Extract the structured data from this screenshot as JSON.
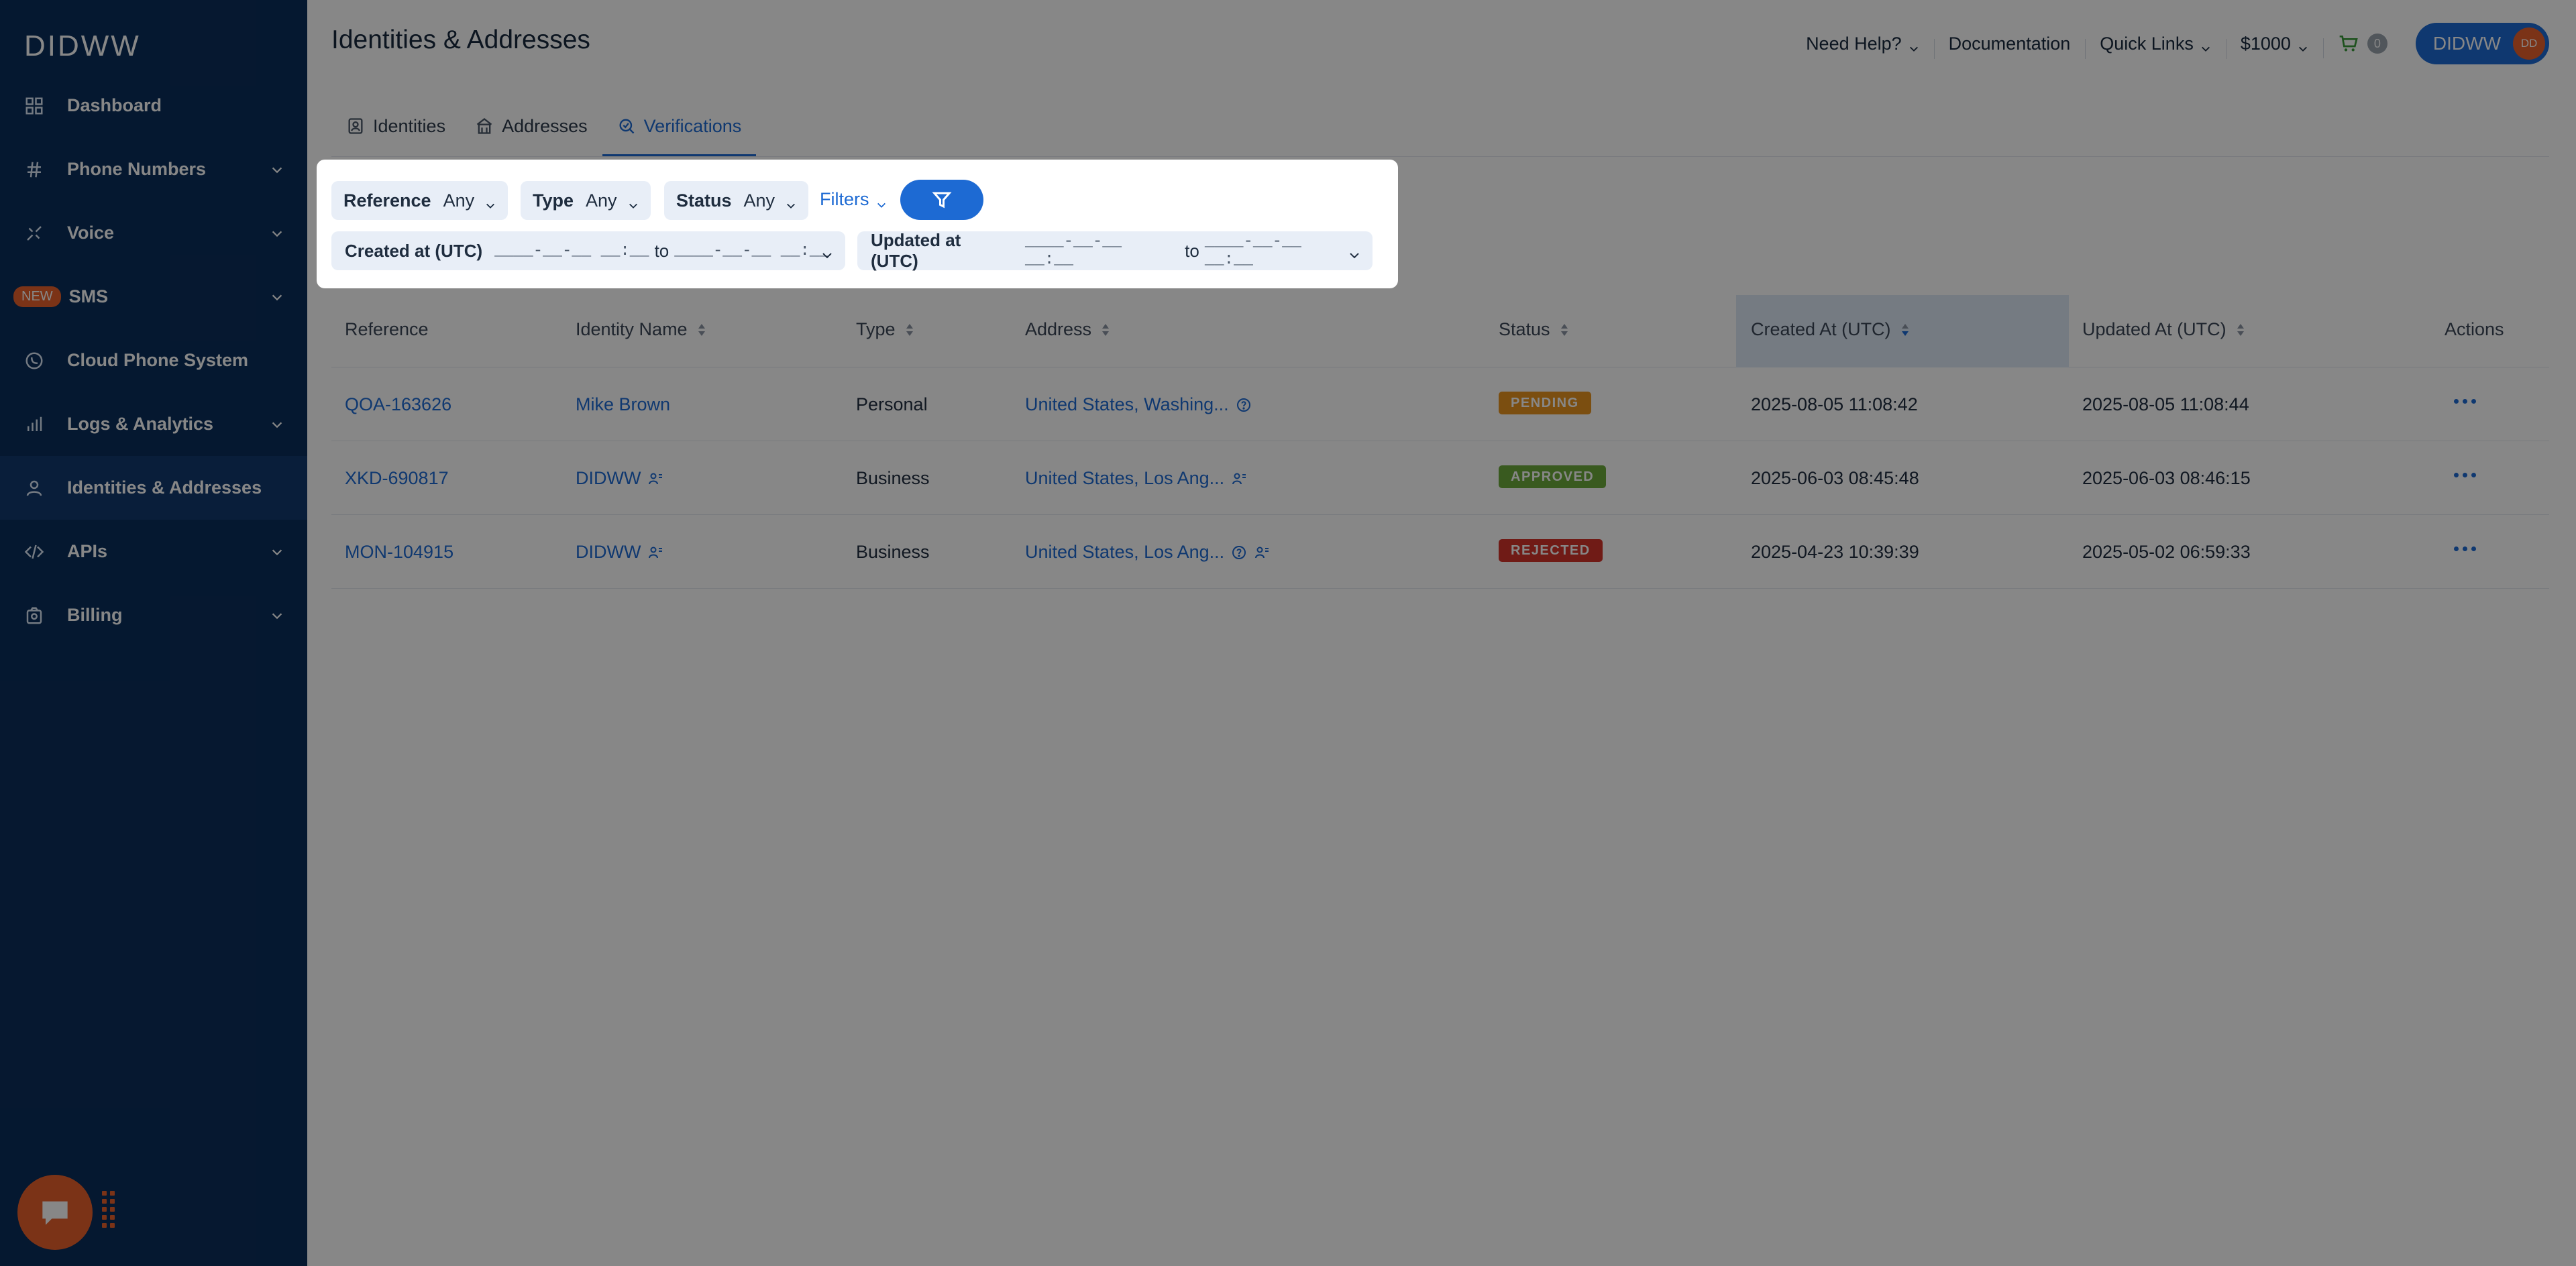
{
  "sidebar": {
    "logo": "DIDWW",
    "items": [
      {
        "label": "Dashboard",
        "icon": "dashboard-icon",
        "expandable": false
      },
      {
        "label": "Phone Numbers",
        "icon": "hash-icon",
        "expandable": true
      },
      {
        "label": "Voice",
        "icon": "voice-icon",
        "expandable": true
      },
      {
        "label": "SMS",
        "icon": "sms-icon",
        "expandable": true,
        "badge": "NEW"
      },
      {
        "label": "Cloud Phone System",
        "icon": "cloud-phone-icon",
        "expandable": false
      },
      {
        "label": "Logs & Analytics",
        "icon": "analytics-icon",
        "expandable": true
      },
      {
        "label": "Identities & Addresses",
        "icon": "user-icon",
        "expandable": false,
        "active": true
      },
      {
        "label": "APIs",
        "icon": "code-icon",
        "expandable": true
      },
      {
        "label": "Billing",
        "icon": "billing-icon",
        "expandable": true
      }
    ]
  },
  "header": {
    "title": "Identities & Addresses",
    "need_help": "Need Help?",
    "documentation": "Documentation",
    "quick_links": "Quick Links",
    "balance": "$1000",
    "cart_count": "0",
    "account_name": "DIDWW",
    "avatar_initials": "DD"
  },
  "tabs": [
    {
      "label": "Identities",
      "active": false
    },
    {
      "label": "Addresses",
      "active": false
    },
    {
      "label": "Verifications",
      "active": true
    }
  ],
  "filters": {
    "reference": {
      "label": "Reference",
      "value": "Any"
    },
    "type": {
      "label": "Type",
      "value": "Any"
    },
    "status": {
      "label": "Status",
      "value": "Any"
    },
    "filters_link": "Filters",
    "created": {
      "label": "Created at (UTC)",
      "from": "____-__-__ __:__",
      "to_word": "to",
      "to": "____-__-__ __:__"
    },
    "updated": {
      "label": "Updated at (UTC)",
      "from": "____-__-__ __:__",
      "to_word": "to",
      "to": "____-__-__ __:__"
    }
  },
  "table": {
    "columns": [
      "Reference",
      "Identity Name",
      "Type",
      "Address",
      "Status",
      "Created At (UTC)",
      "Updated At (UTC)",
      "Actions"
    ],
    "sorted_column": "Created At (UTC)",
    "rows": [
      {
        "reference": "QOA-163626",
        "identity": "Mike Brown",
        "identity_icon": false,
        "type": "Personal",
        "address": "United States, Washing...",
        "address_help": true,
        "address_user": false,
        "status": "PENDING",
        "status_color": "#e8941f",
        "created": "2025-08-05 11:08:42",
        "updated": "2025-08-05 11:08:44"
      },
      {
        "reference": "XKD-690817",
        "identity": "DIDWW",
        "identity_icon": true,
        "type": "Business",
        "address": "United States, Los Ang...",
        "address_help": false,
        "address_user": true,
        "status": "APPROVED",
        "status_color": "#6cab3c",
        "created": "2025-06-03 08:45:48",
        "updated": "2025-06-03 08:46:15"
      },
      {
        "reference": "MON-104915",
        "identity": "DIDWW",
        "identity_icon": true,
        "type": "Business",
        "address": "United States, Los Ang...",
        "address_help": true,
        "address_user": true,
        "status": "REJECTED",
        "status_color": "#d4332b",
        "created": "2025-04-23 10:39:39",
        "updated": "2025-05-02 06:59:33"
      }
    ]
  },
  "colors": {
    "sidebar_bg": "#0b2e5b",
    "accent": "#1d6ad3",
    "orange": "#e8602c"
  }
}
